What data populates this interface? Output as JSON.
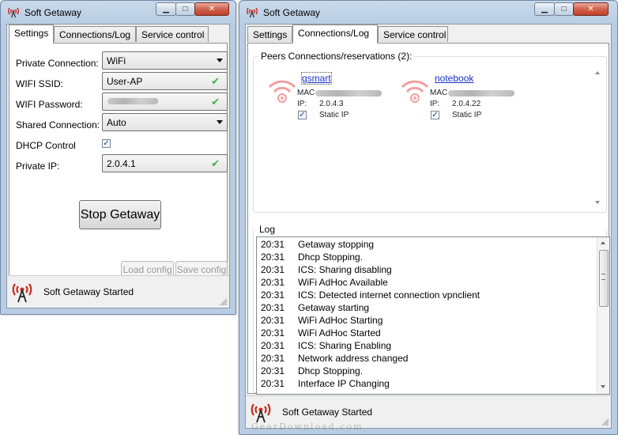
{
  "left_window": {
    "title": "Soft Getaway",
    "tabs": [
      {
        "label": "Settings",
        "active": true
      },
      {
        "label": "Connections/Log",
        "active": false
      },
      {
        "label": "Service control",
        "active": false
      }
    ],
    "fields": {
      "private_connection": {
        "label": "Private Connection:",
        "value": "WiFi"
      },
      "wifi_ssid": {
        "label": "WIFI SSID:",
        "value": "User-AP",
        "valid": true
      },
      "wifi_password": {
        "label": "WIFI Password:",
        "value": "",
        "valid": true
      },
      "shared_connection": {
        "label": "Shared Connection:",
        "value": "Auto"
      },
      "dhcp_control": {
        "label": "DHCP Control",
        "checked": true
      },
      "private_ip": {
        "label": "Private IP:",
        "value": "2.0.4.1",
        "valid": true
      }
    },
    "stop_button": "Stop Getaway",
    "load_config": "Load config",
    "save_config": "Save config",
    "status": "Soft Getaway Started"
  },
  "right_window": {
    "title": "Soft Getaway",
    "tabs": [
      {
        "label": "Settings",
        "active": false
      },
      {
        "label": "Connections/Log",
        "active": true
      },
      {
        "label": "Service control",
        "active": false
      }
    ],
    "peers_title": "Peers Connections/reservations (2):",
    "peers": [
      {
        "name": "gsmart",
        "mac_label": "MAC",
        "ip_label": "IP:",
        "ip": "2.0.4.3",
        "static_ip_label": "Static IP",
        "static": true
      },
      {
        "name": "notebook",
        "mac_label": "MAC",
        "ip_label": "IP:",
        "ip": "2.0.4.22",
        "static_ip_label": "Static IP",
        "static": true
      }
    ],
    "log_title": "Log",
    "log": [
      {
        "time": "20:31",
        "msg": "Getaway stopping"
      },
      {
        "time": "20:31",
        "msg": "Dhcp Stopping."
      },
      {
        "time": "20:31",
        "msg": "ICS: Sharing disabling"
      },
      {
        "time": "20:31",
        "msg": "WiFi AdHoc Available"
      },
      {
        "time": "20:31",
        "msg": "ICS: Detected internet connection vpnclient"
      },
      {
        "time": "20:31",
        "msg": "Getaway starting"
      },
      {
        "time": "20:31",
        "msg": "WiFi AdHoc Starting"
      },
      {
        "time": "20:31",
        "msg": "WiFi AdHoc Started"
      },
      {
        "time": "20:31",
        "msg": "ICS: Sharing Enabling"
      },
      {
        "time": "20:31",
        "msg": "Network address changed"
      },
      {
        "time": "20:31",
        "msg": "Dhcp Stopping."
      },
      {
        "time": "20:31",
        "msg": "Interface IP Changing"
      }
    ],
    "status": "Soft Getaway Started"
  },
  "watermark": "GearDownload.com",
  "colors": {
    "valid_check": "#3cb43c",
    "link": "#1a32c8",
    "wifi_peer_icon": "#f2a0a0",
    "app_icon": "#c8281e"
  }
}
